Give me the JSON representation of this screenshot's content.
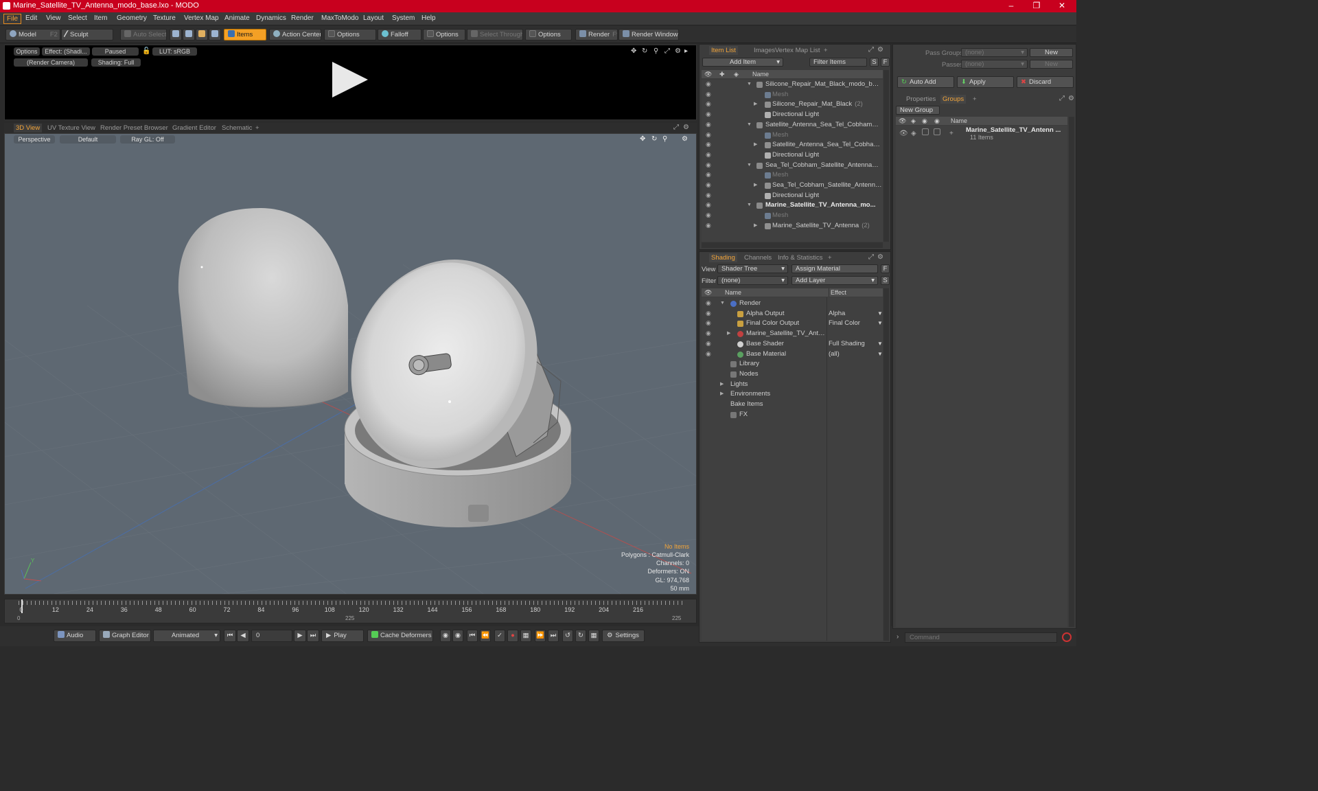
{
  "window": {
    "title": "Marine_Satellite_TV_Antenna_modo_base.lxo - MODO"
  },
  "menu": [
    "File",
    "Edit",
    "View",
    "Select",
    "Item",
    "Geometry",
    "Texture",
    "Vertex Map",
    "Animate",
    "Dynamics",
    "Render",
    "MaxToModo",
    "Layout",
    "System",
    "Help"
  ],
  "toolbar": {
    "model": "Model",
    "model_key": "F2",
    "sculpt": "Sculpt",
    "auto_select": "Auto Select",
    "items": "Items",
    "action_center": "Action Center",
    "options1": "Options",
    "falloff": "Falloff",
    "options2": "Options",
    "select_through": "Select Through",
    "options3": "Options",
    "render": "Render",
    "render_key": "F9",
    "render_window": "Render Window"
  },
  "preview": {
    "options": "Options",
    "effect": "Effect: (Shadi...",
    "status": "Paused",
    "lut": "LUT: sRGB",
    "camera": "(Render Camera)",
    "shading": "Shading: Full"
  },
  "viewport_tabs": [
    "3D View",
    "UV Texture View",
    "Render Preset Browser",
    "Gradient Editor",
    "Schematic",
    "+"
  ],
  "viewport": {
    "projection": "Perspective",
    "style": "Default",
    "raygl": "Ray GL: Off",
    "info": [
      "No Items",
      "Polygons : Catmull-Clark",
      "Channels: 0",
      "Deformers: ON",
      "GL: 974,768",
      "50 mm"
    ],
    "axis_y": "Y"
  },
  "timeline": {
    "ticks": [
      "0",
      "12",
      "24",
      "36",
      "48",
      "60",
      "72",
      "84",
      "96",
      "108",
      "120",
      "132",
      "144",
      "156",
      "168",
      "180",
      "192",
      "204",
      "216"
    ],
    "start": "0",
    "mid": "225",
    "end": "225"
  },
  "bottombar": {
    "audio": "Audio",
    "graph_editor": "Graph Editor",
    "animated": "Animated",
    "frame": "0",
    "play": "Play",
    "cache": "Cache Deformers",
    "settings": "Settings"
  },
  "item_list": {
    "tabs": [
      "Item List",
      "Images",
      "Vertex Map List",
      "+"
    ],
    "add_item": "Add Item",
    "filter": "Filter Items",
    "s": "S",
    "f": "F",
    "col_name": "Name",
    "rows": [
      {
        "label": "Silicone_Repair_Mat_Black_modo_base.lxo",
        "level": 0,
        "kind": "scene"
      },
      {
        "label": "Mesh",
        "level": 1,
        "kind": "mesh"
      },
      {
        "label": "Silicone_Repair_Mat_Black",
        "count": "(2)",
        "level": 1,
        "kind": "group"
      },
      {
        "label": "Directional Light",
        "level": 1,
        "kind": "light"
      },
      {
        "label": "Satellite_Antenna_Sea_Tel_Cobham_mo...",
        "level": 0,
        "kind": "scene"
      },
      {
        "label": "Mesh",
        "level": 1,
        "kind": "mesh"
      },
      {
        "label": "Satellite_Antenna_Sea_Tel_Cobham",
        "count": "(2)",
        "level": 1,
        "kind": "group"
      },
      {
        "label": "Directional Light",
        "level": 1,
        "kind": "light"
      },
      {
        "label": "Sea_Tel_Cobham_Satellite_Antenna_Do ...",
        "level": 0,
        "kind": "scene"
      },
      {
        "label": "Mesh",
        "level": 1,
        "kind": "mesh"
      },
      {
        "label": "Sea_Tel_Cobham_Satellite_Antenna_ ...",
        "level": 1,
        "kind": "group"
      },
      {
        "label": "Directional Light",
        "level": 1,
        "kind": "light"
      },
      {
        "label": "Marine_Satellite_TV_Antenna_mo...",
        "level": 0,
        "kind": "scene",
        "bold": true
      },
      {
        "label": "Mesh",
        "level": 1,
        "kind": "mesh"
      },
      {
        "label": "Marine_Satellite_TV_Antenna",
        "count": "(2)",
        "level": 1,
        "kind": "group"
      }
    ]
  },
  "shading": {
    "tabs": [
      "Shading",
      "Channels",
      "Info & Statistics",
      "+"
    ],
    "view_label": "View",
    "view_value": "Shader Tree",
    "assign": "Assign Material",
    "f": "F",
    "filter_label": "Filter",
    "filter_value": "(none)",
    "add_layer": "Add Layer",
    "s": "S",
    "col_name": "Name",
    "col_effect": "Effect",
    "rows": [
      {
        "label": "Render",
        "effect": "",
        "level": 0
      },
      {
        "label": "Alpha Output",
        "effect": "Alpha",
        "level": 1
      },
      {
        "label": "Final Color Output",
        "effect": "Final Color",
        "level": 1
      },
      {
        "label": "Marine_Satellite_TV_Anten...",
        "effect": "",
        "level": 1
      },
      {
        "label": "Base Shader",
        "effect": "Full Shading",
        "level": 1
      },
      {
        "label": "Base Material",
        "effect": "(all)",
        "level": 1
      },
      {
        "label": "Library",
        "effect": "",
        "level": 0
      },
      {
        "label": "Nodes",
        "effect": "",
        "level": 0
      },
      {
        "label": "Lights",
        "effect": "",
        "level": 0
      },
      {
        "label": "Environments",
        "effect": "",
        "level": 0
      },
      {
        "label": "Bake Items",
        "effect": "",
        "level": 0
      },
      {
        "label": "FX",
        "effect": "",
        "level": 0
      }
    ]
  },
  "groups": {
    "pass_groups_label": "Pass Groups",
    "pass_groups_value": "(none)",
    "new": "New",
    "passes_label": "Passes",
    "passes_value": "(none)",
    "new2": "New",
    "auto_add": "Auto Add",
    "apply": "Apply",
    "discard": "Discard",
    "tabs": [
      "Properties",
      "Groups",
      "+"
    ],
    "new_group": "New Group",
    "col_name": "Name",
    "group_name": "Marine_Satellite_TV_Antenn ...",
    "group_count": "11 Items"
  },
  "command": {
    "placeholder": "Command"
  },
  "colors": {
    "accent": "#f3a53a",
    "title_bar": "#c8001e",
    "viewport_bg": "#5e6872"
  }
}
